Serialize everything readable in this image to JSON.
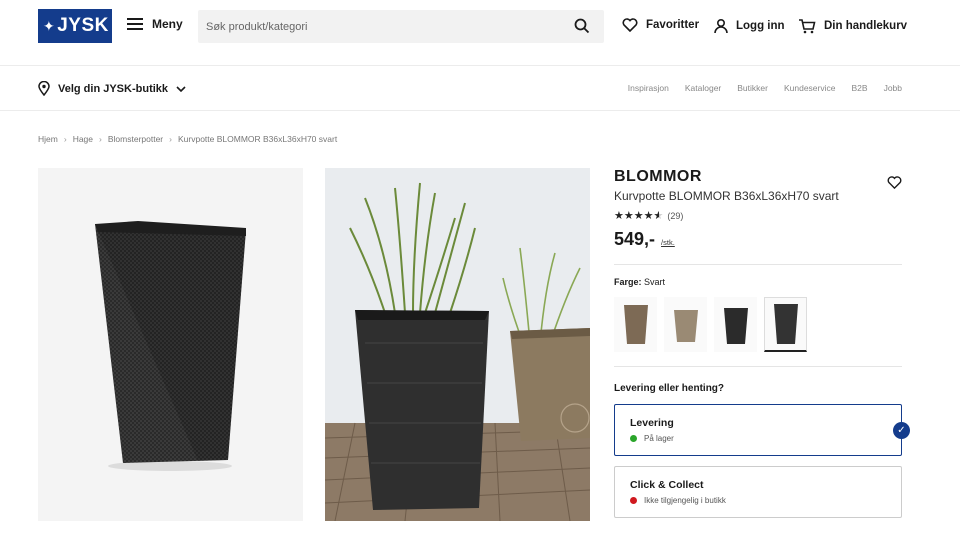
{
  "header": {
    "logo_text": "JYSK",
    "menu_label": "Meny",
    "search_placeholder": "Søk produkt/kategori",
    "favorites_label": "Favoritter",
    "login_label": "Logg inn",
    "cart_label": "Din handlekurv"
  },
  "subnav": {
    "store_label": "Velg din JYSK-butikk",
    "links": [
      "Inspirasjon",
      "Kataloger",
      "Butikker",
      "Kundeservice",
      "B2B",
      "Jobb"
    ]
  },
  "breadcrumbs": [
    "Hjem",
    "Hage",
    "Blomsterpotter",
    "Kurvpotte BLOMMOR B36xL36xH70 svart"
  ],
  "product": {
    "brand": "BLOMMOR",
    "name": "Kurvpotte BLOMMOR B36xL36xH70 svart",
    "rating": 4.5,
    "review_count": "(29)",
    "price": "549,-",
    "price_unit": "/stk.",
    "color_label": "Farge:",
    "color_value": "Svart",
    "swatches": [
      {
        "name": "brun",
        "color": "#7d6a55"
      },
      {
        "name": "beige",
        "color": "#9a8a74"
      },
      {
        "name": "svart",
        "color": "#2b2b2b"
      },
      {
        "name": "svart-valgt",
        "color": "#333333"
      }
    ],
    "selected_swatch": 3
  },
  "delivery": {
    "title": "Levering eller henting?",
    "options": [
      {
        "title": "Levering",
        "status": "På lager",
        "status_color": "#2aa52a",
        "selected": true
      },
      {
        "title": "Click & Collect",
        "status": "Ikke tilgjengelig i butikk",
        "status_color": "#d0191f",
        "selected": false
      }
    ]
  },
  "colors": {
    "brand_blue": "#143c8c"
  }
}
